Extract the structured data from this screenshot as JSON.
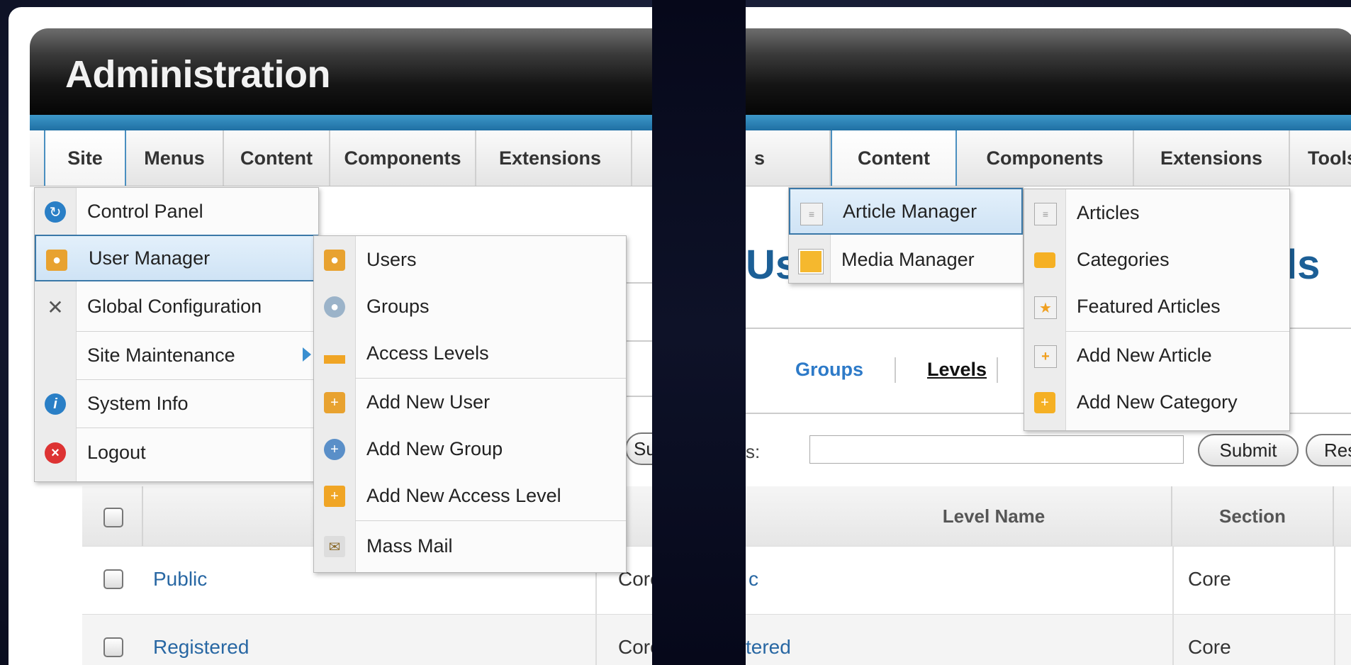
{
  "app_title": "Administration",
  "left": {
    "menubar": [
      "Site",
      "Menus",
      "Content",
      "Components",
      "Extensions"
    ],
    "site_menu": [
      {
        "label": "Control Panel",
        "icon": "control-panel-icon"
      },
      {
        "label": "User Manager",
        "icon": "user-manager-icon"
      },
      {
        "label": "Global Configuration",
        "icon": "global-config-icon"
      },
      {
        "label": "Site Maintenance",
        "icon": ""
      },
      {
        "label": "System Info",
        "icon": "info-icon"
      },
      {
        "label": "Logout",
        "icon": "logout-icon"
      }
    ],
    "user_menu": [
      {
        "label": "Users",
        "icon": "users-icon"
      },
      {
        "label": "Groups",
        "icon": "groups-icon"
      },
      {
        "label": "Access Levels",
        "icon": "access-levels-icon"
      },
      {
        "label": "Add New User",
        "icon": "add-user-icon"
      },
      {
        "label": "Add New Group",
        "icon": "add-group-icon"
      },
      {
        "label": "Add New Access Level",
        "icon": "add-access-level-icon"
      },
      {
        "label": "Mass Mail",
        "icon": "mass-mail-icon"
      }
    ],
    "title_fragment": "s",
    "submit_fragment": "Sub",
    "table_header_fragment": "L",
    "table_header_fragment2": "S",
    "rows": [
      {
        "name": "Public",
        "section": "Core"
      },
      {
        "name": "Registered",
        "section": "Core"
      }
    ]
  },
  "right": {
    "menubar": [
      "s",
      "Content",
      "Components",
      "Extensions",
      "Tools"
    ],
    "content_menu": [
      {
        "label": "Article Manager",
        "icon": "article-manager-icon"
      },
      {
        "label": "Media Manager",
        "icon": "media-manager-icon"
      }
    ],
    "article_menu": [
      {
        "label": "Articles",
        "icon": "articles-icon"
      },
      {
        "label": "Categories",
        "icon": "categories-icon"
      },
      {
        "label": "Featured Articles",
        "icon": "featured-icon"
      },
      {
        "label": "Add New Article",
        "icon": "add-article-icon"
      },
      {
        "label": "Add New Category",
        "icon": "add-category-icon"
      }
    ],
    "title_fragment_a": "Us",
    "title_fragment_b": "ls",
    "subtabs": {
      "groups": "Groups",
      "levels": "Levels"
    },
    "filter_label_fragment": "s:",
    "submit": "Submit",
    "reset": "Reset",
    "columns": [
      "Level Name",
      "Section"
    ],
    "rows": [
      {
        "name": "c",
        "section": "Core"
      },
      {
        "name": "tered",
        "section": "Core"
      }
    ]
  }
}
